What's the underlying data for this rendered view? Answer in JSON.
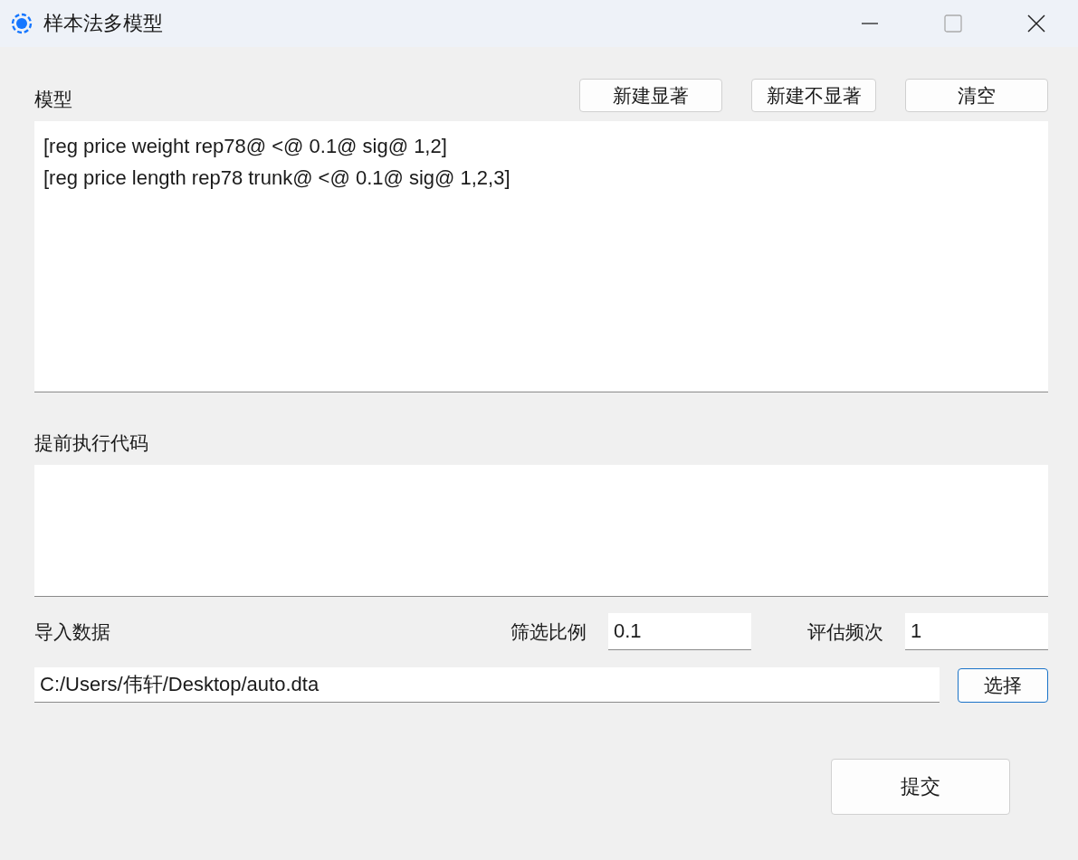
{
  "window": {
    "title": "样本法多模型"
  },
  "model": {
    "label": "模型",
    "buttons": [
      "新建显著",
      "新建不显著",
      "清空"
    ],
    "lines": [
      "[reg price weight rep78@ <@ 0.1@ sig@ 1,2]",
      "[reg price length rep78 trunk@ <@ 0.1@ sig@ 1,2,3]"
    ]
  },
  "pre_code": {
    "label": "提前执行代码"
  },
  "import": {
    "label": "导入数据",
    "ratio_label": "筛选比例",
    "ratio_value": "0.1",
    "freq_label": "评估频次",
    "freq_value": "1",
    "path": "C:/Users/伟轩/Desktop/auto.dta",
    "choose_button": {
      "label": "选择",
      "focused": true
    }
  },
  "submit": "提交"
}
